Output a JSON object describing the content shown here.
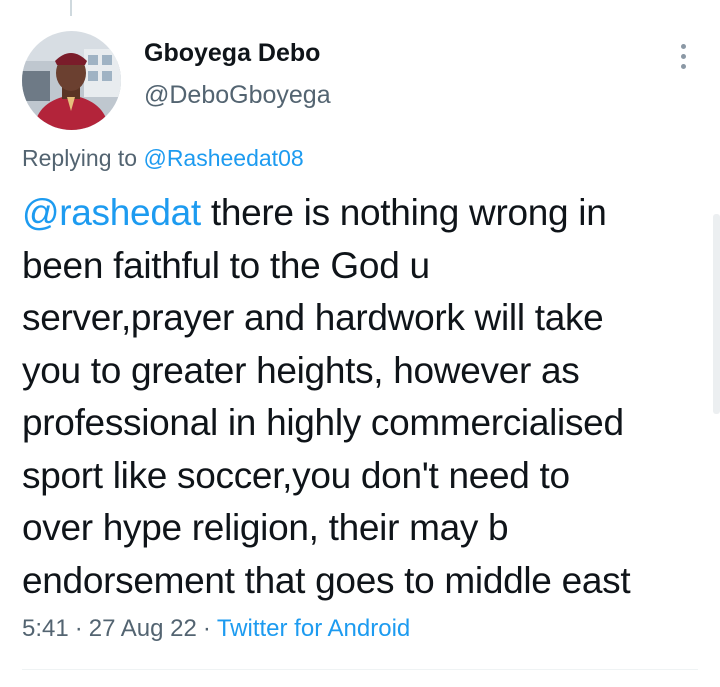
{
  "author": {
    "display_name": "Gboyega Debo",
    "handle": "@DeboGboyega"
  },
  "reply": {
    "prefix": "Replying to ",
    "target": "@Rasheedat08"
  },
  "tweet": {
    "mention": "@rashedat",
    "lines": [
      " there is nothing wrong in",
      "been  faithful to the God u",
      "server,prayer and hardwork will take",
      "you to greater heights, however as",
      "professional in highly commercialised",
      "sport like soccer,you don't need to",
      "over hype  religion, their may b",
      "endorsement that goes to middle east"
    ]
  },
  "meta": {
    "time": "5:41",
    "separator": "·",
    "date": "27 Aug 22",
    "source": "Twitter for Android"
  },
  "icons": {
    "more": "more-vertical-icon",
    "avatar": "profile-photo"
  },
  "colors": {
    "link": "#1d9bf0",
    "secondary_text": "#536471",
    "primary_text": "#0f1419"
  }
}
